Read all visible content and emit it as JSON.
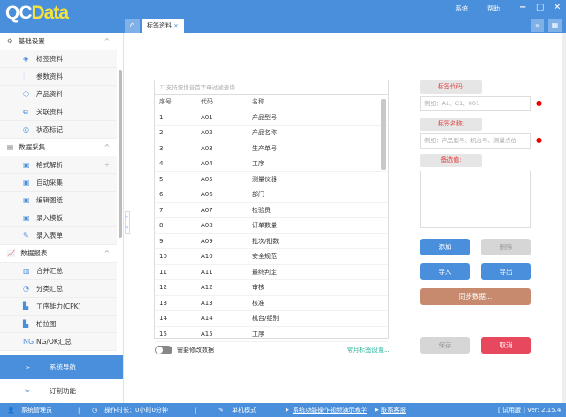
{
  "app": {
    "logo_qc": "QC",
    "logo_data": "Data",
    "menu": [
      "系统",
      "帮助"
    ],
    "window_controls": [
      "−",
      "▢",
      "✕"
    ]
  },
  "tabs": [
    {
      "label": "标签资料",
      "close": "×"
    }
  ],
  "sidebar": {
    "sections": [
      {
        "label": "基础设置",
        "items": [
          "标签资料",
          "参数资料",
          "产品资料",
          "关联资料",
          "状态标记"
        ]
      },
      {
        "label": "数据采集",
        "items": [
          "格式解析",
          "自动采集",
          "编辑图纸",
          "录入模板",
          "录入表单"
        ]
      },
      {
        "label": "数据报表",
        "items": [
          "合并汇总",
          "分类汇总",
          "工序能力(CPK)",
          "柏拉图",
          "NG/OK汇总"
        ]
      }
    ],
    "nav": "系统导航",
    "custom": "订制功能"
  },
  "table": {
    "filter_placeholder": "支持按拼音首字母过滤查询",
    "headers": [
      "序号",
      "代码",
      "名称"
    ],
    "rows": [
      [
        "1",
        "A01",
        "产品型号"
      ],
      [
        "2",
        "A02",
        "产品名称"
      ],
      [
        "3",
        "A03",
        "生产单号"
      ],
      [
        "4",
        "A04",
        "工序"
      ],
      [
        "5",
        "A05",
        "测量仪器"
      ],
      [
        "6",
        "A06",
        "部门"
      ],
      [
        "7",
        "A07",
        "检验员"
      ],
      [
        "8",
        "A08",
        "订单数量"
      ],
      [
        "9",
        "A09",
        "批次/批数"
      ],
      [
        "10",
        "A10",
        "安全规范"
      ],
      [
        "11",
        "A11",
        "最终判定"
      ],
      [
        "12",
        "A12",
        "审核"
      ],
      [
        "13",
        "A13",
        "核准"
      ],
      [
        "14",
        "A14",
        "机台/组别"
      ],
      [
        "15",
        "A15",
        "工序"
      ]
    ]
  },
  "toggle": {
    "label": "需要修改数据",
    "on": false
  },
  "common_link": "常用标签设置...",
  "form": {
    "code_label": "标签代码:",
    "code_placeholder": "例如：A1、C1、001",
    "name_label": "标签名称:",
    "name_placeholder": "例如：产品型号、机台号、测量点位",
    "options_label": "备选值:"
  },
  "buttons": {
    "add": "添加",
    "delete": "删除",
    "import": "导入",
    "export": "导出",
    "sync": "同步数据...",
    "save": "保存",
    "cancel": "取消"
  },
  "status": {
    "user": "系统管理员",
    "duration": "操作时长：0小时0分钟",
    "mode": "单机模式",
    "video_link": "系统功能操作视频演示教学",
    "support_link": "联系客服",
    "version": "[ 试用版 ] Ver: 2.15.4"
  },
  "colors": {
    "primary": "#4a8fdb",
    "sync": "#c88a6e",
    "cancel": "#e8485e",
    "disabled": "#d6d6d6"
  }
}
